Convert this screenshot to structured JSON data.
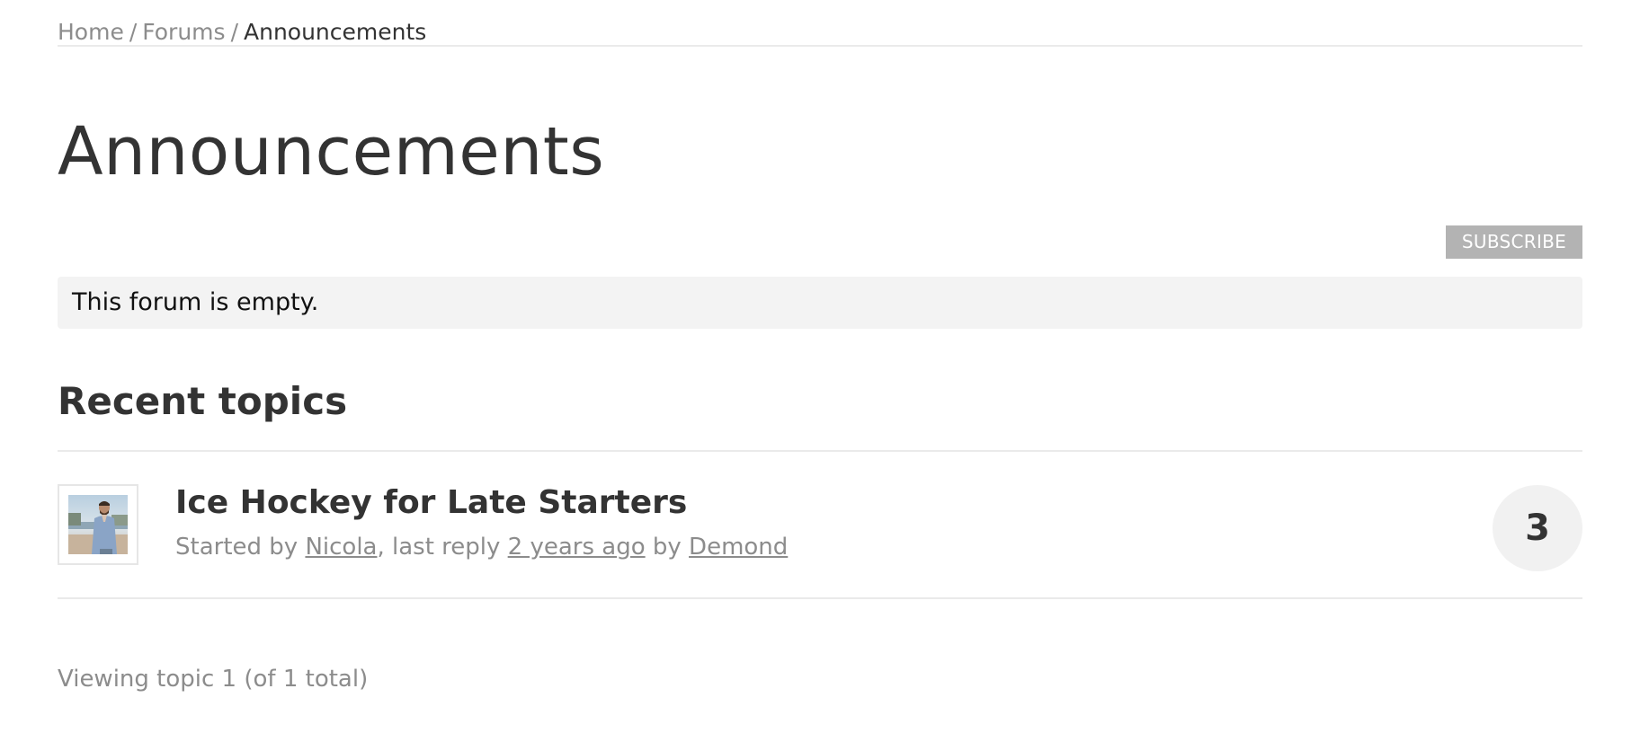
{
  "breadcrumb": {
    "items": [
      {
        "label": "Home"
      },
      {
        "label": "Forums"
      }
    ],
    "separator": "/",
    "current": "Announcements"
  },
  "page": {
    "title": "Announcements"
  },
  "actions": {
    "subscribe_label": "SUBSCRIBE"
  },
  "notice": {
    "text": "This forum is empty."
  },
  "recent_topics": {
    "heading": "Recent topics",
    "topics": [
      {
        "title": "Ice Hockey for Late Starters",
        "avatar_icon": "user-photo-avatar",
        "meta_prefix": "Started by",
        "author": "Nicola",
        "meta_middle": ", last reply",
        "last_reply": "2 years ago",
        "meta_by": "by",
        "last_reply_author": "Demond",
        "reply_count": "3"
      }
    ]
  },
  "pagination": {
    "summary": "Viewing topic 1 (of 1 total)"
  },
  "colors": {
    "text": "#333333",
    "muted": "#8c8c8c",
    "divider": "#eaeaea",
    "notice_bg": "#f3f3f3",
    "button_bg": "#b3b3b3",
    "badge_bg": "#f1f1f1"
  }
}
